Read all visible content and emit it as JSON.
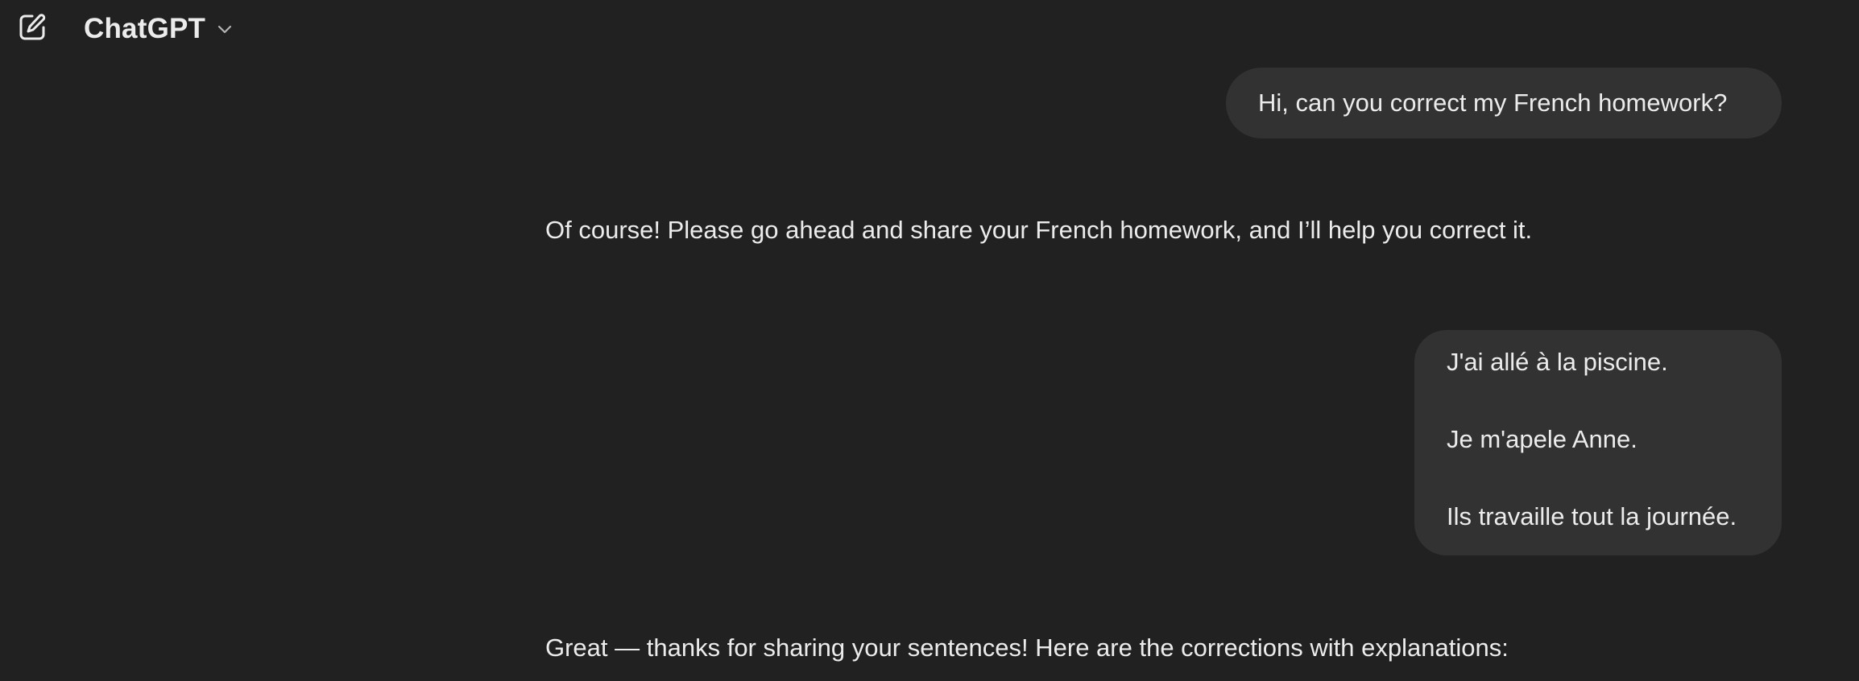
{
  "header": {
    "new_chat_icon": "new-chat-edit-icon",
    "model_name": "ChatGPT",
    "chevron_icon": "chevron-down-icon"
  },
  "conversation": {
    "messages": [
      {
        "role": "user",
        "lines": [
          "Hi, can you correct my French homework?"
        ]
      },
      {
        "role": "assistant",
        "text": "Of course! Please go ahead and share your French homework, and I’ll help you correct it."
      },
      {
        "role": "user",
        "lines": [
          "J'ai allé à la piscine.",
          "Je m'apele Anne.",
          "Ils travaille tout la journée."
        ]
      },
      {
        "role": "assistant",
        "text": "Great — thanks for sharing your sentences! Here are the corrections with explanations:"
      }
    ]
  },
  "colors": {
    "background": "#212121",
    "user_bubble": "#323232",
    "text": "#ececec"
  }
}
